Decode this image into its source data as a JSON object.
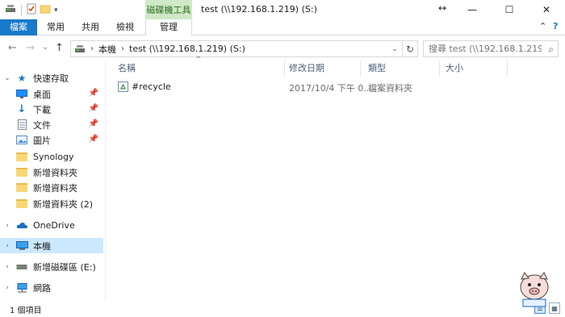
{
  "window": {
    "title": "test (\\\\192.168.1.219) (S:)",
    "context_tab_group": "磁碟機工具",
    "controls": {
      "resize": "↔",
      "minimize": "—",
      "maximize": "☐",
      "close": "✕"
    }
  },
  "ribbon": {
    "tabs": [
      {
        "label": "檔案"
      },
      {
        "label": "常用"
      },
      {
        "label": "共用"
      },
      {
        "label": "檢視"
      },
      {
        "label": "管理"
      }
    ],
    "collapse_glyph": "⌃",
    "help_glyph": "?"
  },
  "nav": {
    "back": "←",
    "forward": "→",
    "recent": "⌄",
    "up": "↑",
    "breadcrumb": [
      "本機",
      "test (\\\\192.168.1.219) (S:)"
    ],
    "search_placeholder": "搜尋 test (\\\\192.168.1.219) (..."
  },
  "navpane": {
    "quick_access": "快速存取",
    "quick_items": [
      {
        "label": "桌面",
        "icon": "desktop-icon",
        "pinned": true
      },
      {
        "label": "下載",
        "icon": "download-icon",
        "pinned": true
      },
      {
        "label": "文件",
        "icon": "document-icon",
        "pinned": true
      },
      {
        "label": "圖片",
        "icon": "picture-icon",
        "pinned": true
      },
      {
        "label": "Synology",
        "icon": "folder-icon",
        "pinned": false
      },
      {
        "label": "新增資料夾",
        "icon": "folder-icon",
        "pinned": false
      },
      {
        "label": "新增資料夾",
        "icon": "folder-icon",
        "pinned": false
      },
      {
        "label": "新增資料夾 (2)",
        "icon": "folder-icon",
        "pinned": false
      }
    ],
    "onedrive": "OneDrive",
    "this_pc": "本機",
    "drive_e": "新增磁碟區 (E:)",
    "network": "網路"
  },
  "columns": {
    "name": "名稱",
    "modified": "修改日期",
    "type": "類型",
    "size": "大小"
  },
  "files": [
    {
      "name": "#recycle",
      "modified": "2017/10/4 下午 0...",
      "type": "檔案資料夾",
      "size": ""
    }
  ],
  "status": {
    "count": "1 個項目"
  },
  "colors": {
    "file_tab": "#1979ca",
    "context_tab": "#cfe9c6",
    "selection": "#cce8ff",
    "header_text": "#4c607a"
  }
}
